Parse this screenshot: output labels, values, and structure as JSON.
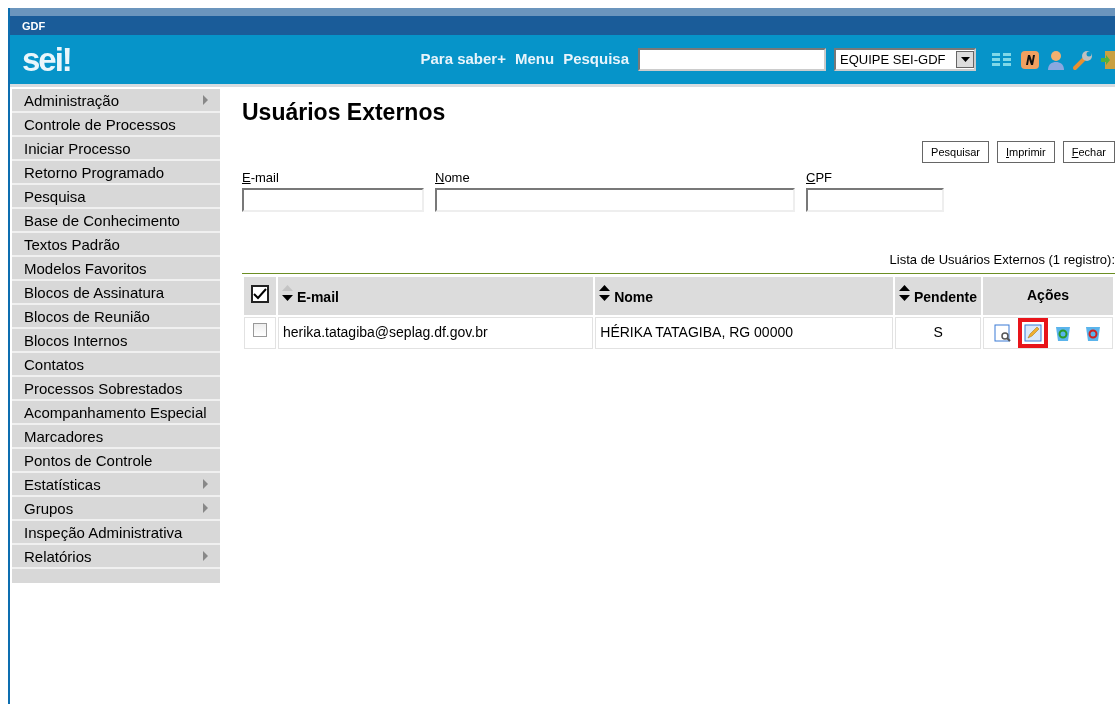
{
  "header": {
    "org": "GDF",
    "logo": "sei!",
    "links": [
      "Para saber+",
      "Menu",
      "Pesquisa"
    ],
    "unit_select": {
      "value": "EQUIPE SEI-GDF"
    },
    "icons": [
      {
        "kind": "list"
      },
      {
        "kind": "note"
      },
      {
        "kind": "user"
      },
      {
        "kind": "wrench"
      },
      {
        "kind": "exit"
      }
    ]
  },
  "sidebar": {
    "items": [
      {
        "label": "Administração",
        "submenu": true
      },
      {
        "label": "Controle de Processos",
        "submenu": false
      },
      {
        "label": "Iniciar Processo",
        "submenu": false
      },
      {
        "label": "Retorno Programado",
        "submenu": false
      },
      {
        "label": "Pesquisa",
        "submenu": false
      },
      {
        "label": "Base de Conhecimento",
        "submenu": false
      },
      {
        "label": "Textos Padrão",
        "submenu": false
      },
      {
        "label": "Modelos Favoritos",
        "submenu": false
      },
      {
        "label": "Blocos de Assinatura",
        "submenu": false
      },
      {
        "label": "Blocos de Reunião",
        "submenu": false
      },
      {
        "label": "Blocos Internos",
        "submenu": false
      },
      {
        "label": "Contatos",
        "submenu": false
      },
      {
        "label": "Processos Sobrestados",
        "submenu": false
      },
      {
        "label": "Acompanhamento Especial",
        "submenu": false
      },
      {
        "label": "Marcadores",
        "submenu": false
      },
      {
        "label": "Pontos de Controle",
        "submenu": false
      },
      {
        "label": "Estatísticas",
        "submenu": true
      },
      {
        "label": "Grupos",
        "submenu": true
      },
      {
        "label": "Inspeção Administrativa",
        "submenu": false
      },
      {
        "label": "Relatórios",
        "submenu": true
      }
    ]
  },
  "page_title": "Usuários Externos",
  "buttons": [
    {
      "label": "Pesquisar",
      "underline_first": false
    },
    {
      "label": "Imprimir",
      "underline_first": true
    },
    {
      "label": "Fechar",
      "underline_first": true
    }
  ],
  "filters": [
    {
      "label": "E-mail",
      "underline_first": true
    },
    {
      "label": "Nome",
      "underline_first": true
    },
    {
      "label": "CPF",
      "underline_first": true
    }
  ],
  "table": {
    "caption": "Lista de Usuários Externos (1 registro):",
    "select_all": {
      "checked": true
    },
    "columns": [
      {
        "label": "E-mail",
        "sortable": true,
        "sorted": true
      },
      {
        "label": "Nome",
        "sortable": true,
        "sorted": false
      },
      {
        "label": "Pendente",
        "sortable": true,
        "sorted": false
      },
      {
        "label": "Ações",
        "sortable": false
      }
    ],
    "rows": [
      {
        "checked": false,
        "email": "herika.tatagiba@seplag.df.gov.br",
        "nome": "HÉRIKA TATAGIBA, RG 00000",
        "pendente": "S",
        "actions": [
          {
            "kind": "view",
            "highlighted": false
          },
          {
            "kind": "edit",
            "highlighted": true
          },
          {
            "kind": "reactivate",
            "highlighted": false
          },
          {
            "kind": "delete",
            "highlighted": false
          }
        ]
      }
    ]
  }
}
